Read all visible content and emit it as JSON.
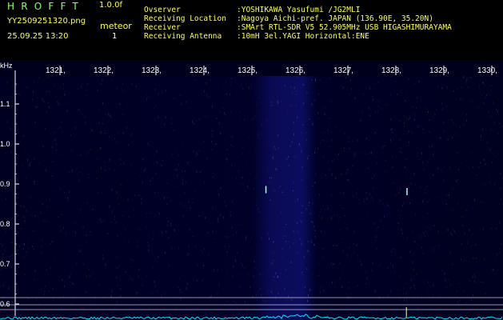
{
  "header": {
    "logo": "HROFFT",
    "version": "1.0.0f",
    "filename": "YY2509251320.png",
    "datetime": "25.09.25 13:20",
    "meteor_label": "meteor",
    "meteor_count": "1",
    "info": [
      {
        "key": "Ovserver",
        "value": ":YOSHIKAWA Yasufumi /JG2MLI"
      },
      {
        "key": "Receiving Location",
        "value": ":Nagoya Aichi-pref. JAPAN (136.90E, 35.20N)"
      },
      {
        "key": "Receiver",
        "value": ":SMArt RTL-SDR V5 52.905MHz USB HIGASHIMURAYAMA"
      },
      {
        "key": "Receiving Antenna",
        "value": ":10mH 3el.YAGI Horizontal:ENE"
      }
    ]
  },
  "colors": {
    "header_green": "#8dff6a",
    "header_yellow": "#ffff5a",
    "background": "#000033",
    "axis": "#ffffff",
    "spectrum": "#00e5ff"
  },
  "chart_data": {
    "type": "heatmap",
    "ylabel": "kHz",
    "x_ticks": [
      "1321",
      "1322",
      "1323",
      "1324",
      "1325",
      "1326",
      "1327",
      "1328",
      "1329",
      "1330"
    ],
    "y_ticks": [
      "1.1",
      "1.0",
      "0.9",
      "0.8",
      "0.7",
      "0.6"
    ],
    "ylim": [
      0.58,
      1.2
    ],
    "grid": false,
    "meteor_echoes": [
      {
        "time": 1325.28,
        "freq_khz": 0.885
      },
      {
        "time": 1328.22,
        "freq_khz": 0.88
      }
    ],
    "reference_lines_khz": [
      0.618,
      0.6,
      0.588
    ]
  }
}
